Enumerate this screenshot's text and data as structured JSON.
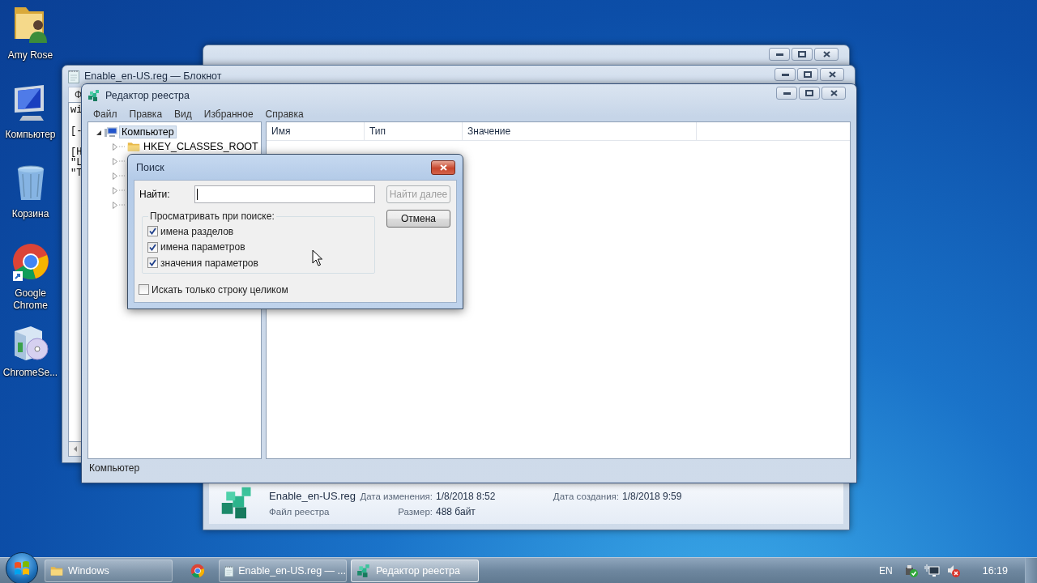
{
  "desktop_icons": [
    {
      "label": "Amy Rose",
      "kind": "user-folder"
    },
    {
      "label": "Компьютер",
      "kind": "computer"
    },
    {
      "label": "Корзина",
      "kind": "recycle-bin"
    },
    {
      "label": "Google Chrome",
      "kind": "chrome"
    },
    {
      "label": "ChromeSe...",
      "kind": "installer"
    }
  ],
  "explorer_window": {
    "details": {
      "file_name": "Enable_en-US.reg",
      "file_type": "Файл реестра",
      "modified_label": "Дата изменения:",
      "modified": "1/8/2018 8:52",
      "size_label": "Размер:",
      "size": "488 байт",
      "created_label": "Дата создания:",
      "created": "1/8/2018 9:59"
    }
  },
  "notepad_window": {
    "title": "Enable_en-US.reg — Блокнот",
    "menu": [
      "Ф"
    ],
    "paragraphs": [
      [
        "wi"
      ],
      [
        "[-"
      ],
      [
        "[H",
        "\"L",
        "\"T"
      ]
    ]
  },
  "registry_window": {
    "title": "Редактор реестра",
    "menu": [
      "Файл",
      "Правка",
      "Вид",
      "Избранное",
      "Справка"
    ],
    "tree": [
      {
        "label": "Компьютер",
        "expanded": true,
        "selected": true,
        "children": [
          {
            "label": "HKEY_CLASSES_ROOT",
            "expanded": false,
            "selected": false
          },
          {
            "expanded": false
          },
          {
            "expanded": false
          },
          {
            "expanded": false
          },
          {
            "expanded": false
          }
        ]
      }
    ],
    "columns": [
      "Имя",
      "Тип",
      "Значение"
    ],
    "status_bar": "Компьютер"
  },
  "find_dialog": {
    "title": "Поиск",
    "find_label": "Найти:",
    "buttons": [
      {
        "label": "Найти далее",
        "disabled": true
      },
      {
        "label": "Отмена",
        "disabled": false
      }
    ],
    "group_label": "Просматривать при поиске:",
    "options": [
      {
        "label": "имена разделов",
        "checked": true
      },
      {
        "label": "имена параметров",
        "checked": true
      },
      {
        "label": "значения параметров",
        "checked": true
      }
    ],
    "whole_string": {
      "label": "Искать только строку целиком",
      "checked": false
    }
  },
  "taskbar": {
    "items": [
      {
        "label": "Windows",
        "kind": "folder",
        "selected": false
      },
      {
        "kind": "chrome",
        "selected": false
      },
      {
        "label": "Enable_en-US.reg — ...",
        "kind": "notepad",
        "selected": false
      },
      {
        "label": "Редактор реестра",
        "kind": "regedit",
        "selected": true
      }
    ],
    "language": "EN",
    "clock": "16:19"
  }
}
